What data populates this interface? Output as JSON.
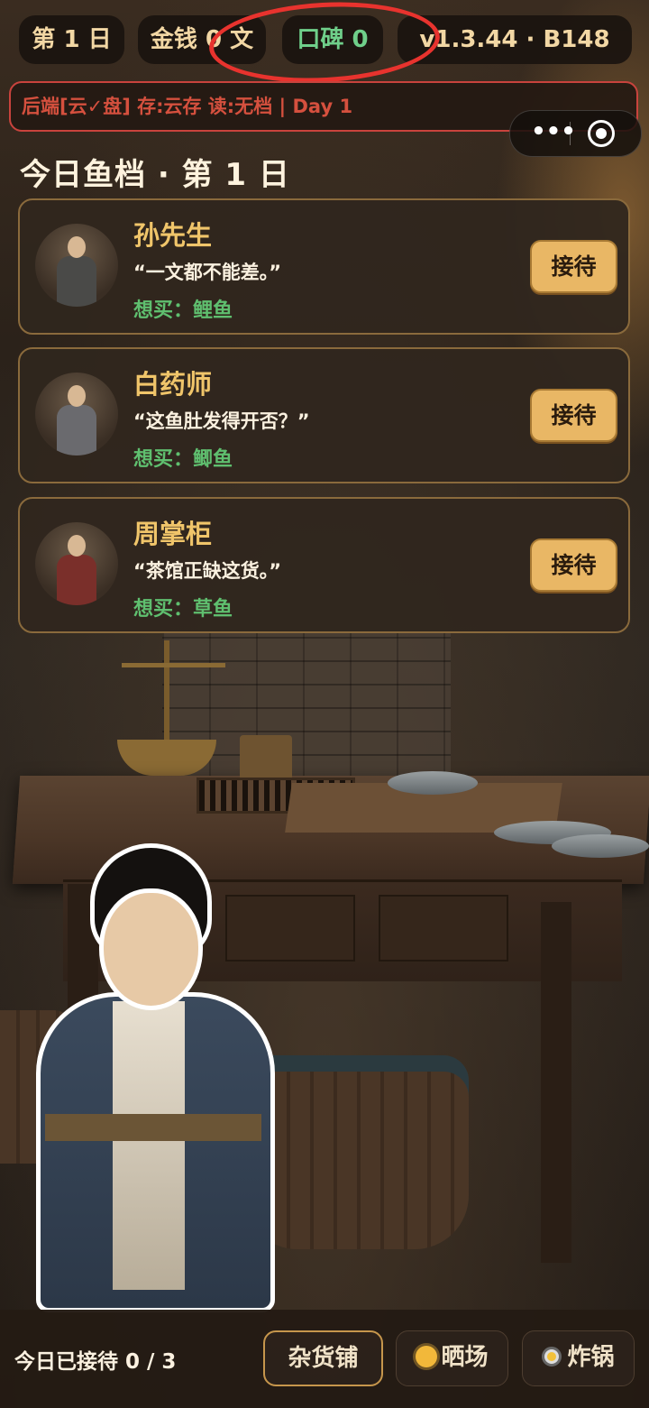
{
  "status": {
    "day_label": "第 1 日",
    "money_label": "金钱 0 文",
    "reputation_label": "口碑 0",
    "version_label": "v1.3.44 · B148"
  },
  "backend": {
    "text": "后端[云✓盘] 存:云存 读:无档 | Day 1"
  },
  "capsule": {
    "more_icon": "•••"
  },
  "section": {
    "title": "今日鱼档 · 第 1 日"
  },
  "customers": [
    {
      "name": "孙先生",
      "quote": "“一文都不能差。”",
      "want": "想买：鲤鱼",
      "button": "接待"
    },
    {
      "name": "白药师",
      "quote": "“这鱼肚发得开否？”",
      "want": "想买：鲫鱼",
      "button": "接待"
    },
    {
      "name": "周掌柜",
      "quote": "“茶馆正缺这货。”",
      "want": "想买：草鱼",
      "button": "接待"
    }
  ],
  "bottom": {
    "served_label": "今日已接待 0 / 3",
    "nav": {
      "shop": "杂货铺",
      "drying": "晒场",
      "fryer": "炸锅"
    }
  },
  "colors": {
    "accent_gold": "#e9b765",
    "name_gold": "#f0c56a",
    "want_green": "#5fbf6f",
    "annotation_red": "#e8332e"
  }
}
